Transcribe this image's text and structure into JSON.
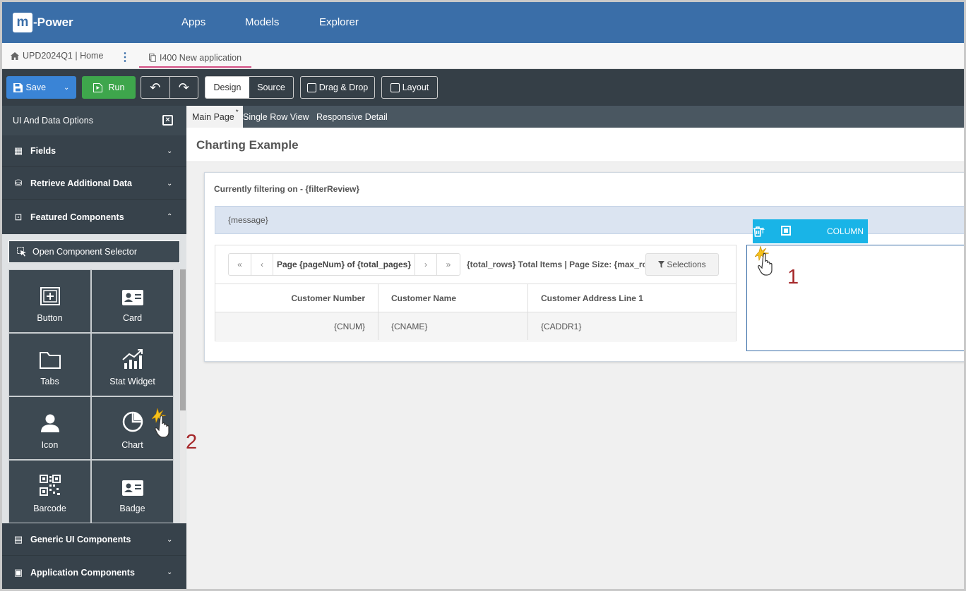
{
  "header": {
    "logo_m": "m",
    "logo_text": "-Power",
    "nav": [
      "Apps",
      "Models",
      "Explorer"
    ]
  },
  "breadcrumb": {
    "home": "UPD2024Q1 | Home",
    "active_tab": "I400 New application"
  },
  "toolbar": {
    "save": "Save",
    "run": "Run",
    "design": "Design",
    "source": "Source",
    "drag_drop": "Drag & Drop",
    "layout": "Layout"
  },
  "sidebar": {
    "title": "UI And Data Options",
    "sections": [
      "Fields",
      "Retrieve Additional Data",
      "Featured Components"
    ],
    "open_selector": "Open Component Selector",
    "tiles": [
      "Button",
      "Card",
      "Tabs",
      "Stat Widget",
      "Icon",
      "Chart",
      "Barcode",
      "Badge"
    ],
    "bottom_sections": [
      "Generic UI Components",
      "Application Components"
    ]
  },
  "page_tabs": {
    "main": "Main Page",
    "main_marker": "*",
    "single": "Single Row View",
    "responsive": "Responsive Detail"
  },
  "canvas": {
    "title": "Charting Example",
    "filter": "Currently filtering on - {filterReview}",
    "message": "{message}",
    "pager": {
      "first": "«",
      "prev": "‹",
      "page": "Page {pageNum} of {total_pages}",
      "next": "›",
      "last": "»"
    },
    "totals": "{total_rows} Total Items | Page Size: {max_rowsp",
    "selections": "Selections",
    "columns": [
      "Customer Number",
      "Customer Name",
      "Customer Address Line 1"
    ],
    "row": [
      "{CNUM}",
      "{CNAME}",
      "{CADDR1}"
    ],
    "column_toolbar_label": "COLUMN"
  },
  "annotations": {
    "step1": "1",
    "step2": "2"
  },
  "colors": {
    "topbar": "#3a6ea8",
    "toolbar": "#353f47",
    "sidebar": "#37424b",
    "column_toolbar": "#19b4e7",
    "annotation": "#a5282a"
  }
}
